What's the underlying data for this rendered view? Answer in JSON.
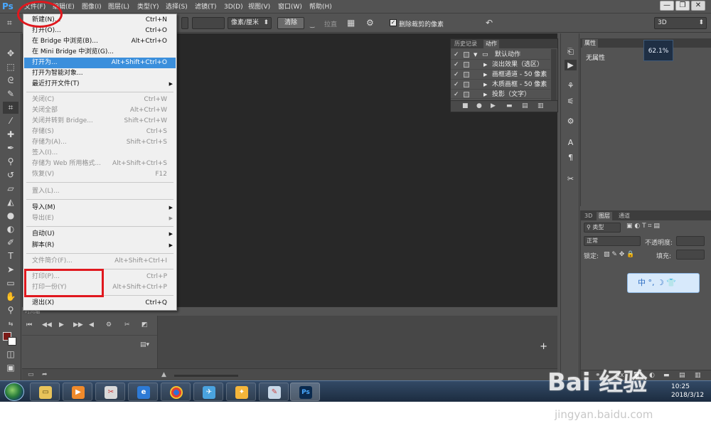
{
  "app": {
    "logo": "Ps"
  },
  "menubar": {
    "items": [
      "文件(F)",
      "编辑(E)",
      "图像(I)",
      "图层(L)",
      "类型(Y)",
      "选择(S)",
      "滤镜(T)",
      "3D(D)",
      "视图(V)",
      "窗口(W)",
      "帮助(H)"
    ],
    "window_controls": {
      "minimize": "—",
      "restore": "❐",
      "close": "✕"
    }
  },
  "options_bar": {
    "units": "像素/厘米",
    "clear_label": "清除",
    "straighten_label": "拉直",
    "delete_cropped": "删除裁剪的像素",
    "workspace": "3D"
  },
  "file_menu": {
    "items": [
      {
        "label": "新建(N)...",
        "shortcut": "Ctrl+N",
        "disabled": false
      },
      {
        "label": "打开(O)...",
        "shortcut": "Ctrl+O",
        "disabled": false
      },
      {
        "label": "在 Bridge 中浏览(B)...",
        "shortcut": "Alt+Ctrl+O",
        "disabled": false
      },
      {
        "label": "在 Mini Bridge 中浏览(G)...",
        "shortcut": "",
        "disabled": false
      },
      {
        "label": "打开为...",
        "shortcut": "Alt+Shift+Ctrl+O",
        "disabled": false,
        "highlighted": true
      },
      {
        "label": "打开为智能对象...",
        "shortcut": "",
        "disabled": false
      },
      {
        "label": "最近打开文件(T)",
        "shortcut": "",
        "disabled": false,
        "submenu": true
      },
      {
        "label": "关闭(C)",
        "shortcut": "Ctrl+W",
        "disabled": true
      },
      {
        "label": "关闭全部",
        "shortcut": "Alt+Ctrl+W",
        "disabled": true
      },
      {
        "label": "关闭并转到 Bridge...",
        "shortcut": "Shift+Ctrl+W",
        "disabled": true
      },
      {
        "label": "存储(S)",
        "shortcut": "Ctrl+S",
        "disabled": true
      },
      {
        "label": "存储为(A)...",
        "shortcut": "Shift+Ctrl+S",
        "disabled": true
      },
      {
        "label": "签入(I)...",
        "shortcut": "",
        "disabled": true
      },
      {
        "label": "存储为 Web 所用格式...",
        "shortcut": "Alt+Shift+Ctrl+S",
        "disabled": true
      },
      {
        "label": "恢复(V)",
        "shortcut": "F12",
        "disabled": true
      },
      {
        "label": "置入(L)...",
        "shortcut": "",
        "disabled": true
      },
      {
        "label": "导入(M)",
        "shortcut": "",
        "disabled": false,
        "submenu": true
      },
      {
        "label": "导出(E)",
        "shortcut": "",
        "disabled": true,
        "submenu": true
      },
      {
        "label": "自动(U)",
        "shortcut": "",
        "disabled": false,
        "submenu": true
      },
      {
        "label": "脚本(R)",
        "shortcut": "",
        "disabled": false,
        "submenu": true
      },
      {
        "label": "文件简介(F)...",
        "shortcut": "Alt+Shift+Ctrl+I",
        "disabled": true
      },
      {
        "label": "打印(P)...",
        "shortcut": "Ctrl+P",
        "disabled": true
      },
      {
        "label": "打印一份(Y)",
        "shortcut": "Alt+Shift+Ctrl+P",
        "disabled": true
      },
      {
        "label": "退出(X)",
        "shortcut": "Ctrl+Q",
        "disabled": false
      }
    ]
  },
  "actions_panel": {
    "tabs": [
      "历史记录",
      "动作"
    ],
    "active_tab": "动作",
    "rows": [
      {
        "text": "默认动作",
        "folder": true
      },
      {
        "text": "淡出效果（选区）"
      },
      {
        "text": "画框通道 - 50 像素"
      },
      {
        "text": "木质画框 - 50 像素"
      },
      {
        "text": "投影（文字）"
      }
    ]
  },
  "timeline": {
    "tab": "时间轴"
  },
  "properties_panel": {
    "tab": "属性",
    "value": "无属性"
  },
  "zoom_badge": "62.1%",
  "layers_panel": {
    "tabs": [
      "3D",
      "图层",
      "通道"
    ],
    "active_tab": "图层",
    "kind": "类型",
    "blend_mode": "正常",
    "opacity_label": "不透明度:",
    "lock_label": "锁定:",
    "fill_label": "填充:"
  },
  "ime_bar": "中 °, ☽ 👕",
  "taskbar": {
    "time": "10:25",
    "date": "2018/3/12"
  },
  "watermark": {
    "logo": "Bai 经验",
    "url": "jingyan.baidu.com"
  }
}
